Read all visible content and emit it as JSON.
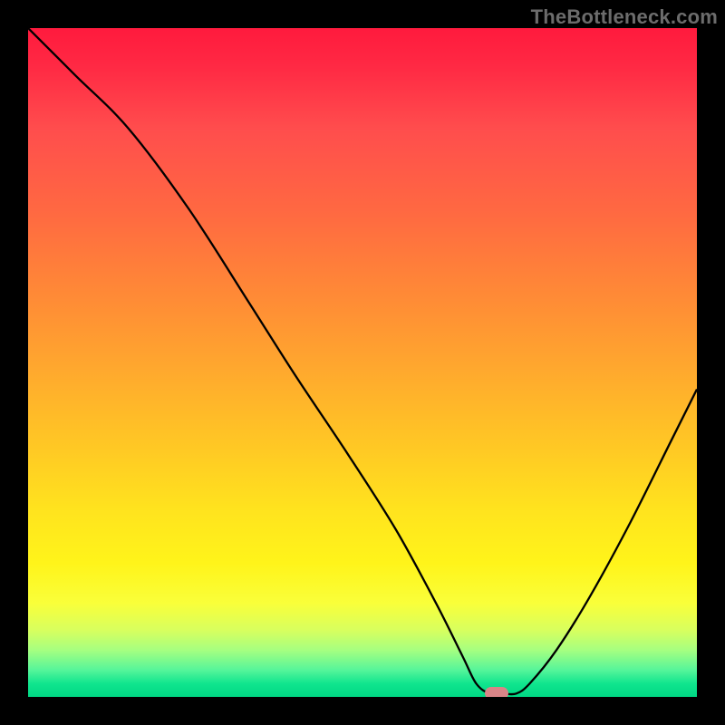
{
  "watermark": "TheBottleneck.com",
  "chart_data": {
    "type": "line",
    "title": "",
    "xlabel": "",
    "ylabel": "",
    "xlim": [
      0,
      100
    ],
    "ylim": [
      0,
      100
    ],
    "grid": false,
    "series": [
      {
        "name": "curve",
        "x": [
          0,
          7,
          15,
          24,
          33,
          40,
          48,
          55,
          61,
          65,
          67,
          69,
          71,
          73,
          75,
          79,
          84,
          90,
          96,
          100
        ],
        "values": [
          100,
          93,
          85,
          73,
          59,
          48,
          36,
          25,
          14,
          6,
          2,
          0.5,
          0.5,
          0.5,
          2,
          7,
          15,
          26,
          38,
          46
        ]
      }
    ],
    "marker": {
      "x": 70,
      "y": 0.5
    }
  }
}
